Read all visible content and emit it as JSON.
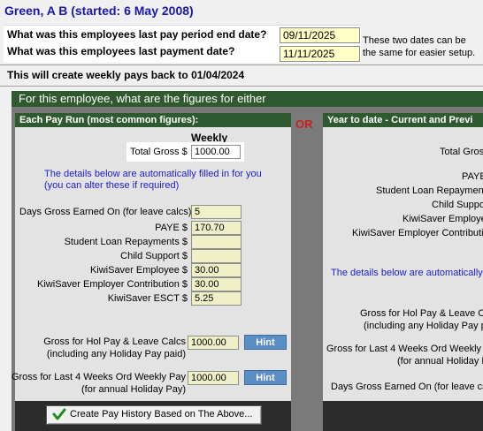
{
  "header": {
    "title": "Green, A B (started: 6 May 2008)"
  },
  "questions": {
    "end_date_label": "What was this employees last pay period end date?",
    "end_date_value": "09/11/2025",
    "payment_date_label": "What was this employees last payment date?",
    "payment_date_value": "11/11/2025",
    "note_line1": "These two dates can be",
    "note_line2": "the same for easier setup."
  },
  "create_info": "This will create weekly pays back to 01/04/2024",
  "band_title": "For this employee, what are the figures for either",
  "or_label": "OR",
  "left_panel": {
    "header": "Each Pay Run (most common figures):",
    "col_heading": "Weekly",
    "total_gross_label": "Total Gross $",
    "total_gross_value": "1000.00",
    "auto_note_line1": "The details below are automatically filled in for you",
    "auto_note_line2": "(you can alter these if required)",
    "rows": [
      {
        "label": "Days Gross Earned On (for leave calcs)",
        "value": "5"
      },
      {
        "label": "PAYE $",
        "value": "170.70"
      },
      {
        "label": "Student Loan Repayments $",
        "value": ""
      },
      {
        "label": "Child Support $",
        "value": ""
      },
      {
        "label": "KiwiSaver Employee $",
        "value": "30.00"
      },
      {
        "label": "KiwiSaver Employer Contribution $",
        "value": "30.00"
      },
      {
        "label": "KiwiSaver ESCT $",
        "value": "5.25"
      }
    ],
    "hol_label_line1": "Gross for Hol Pay & Leave Calcs",
    "hol_label_line2": "(including any Holiday Pay paid)",
    "hol_value": "1000.00",
    "last4_label_line1": "Gross for Last 4 Weeks Ord Weekly Pay",
    "last4_label_line2": "(for annual Holiday Pay)",
    "last4_value": "1000.00",
    "hint_label": "Hint",
    "create_button": "Create Pay History Based on The Above..."
  },
  "right_panel": {
    "header": "Year to date - Current and Previ",
    "total_gross_label": "Total Gros",
    "rows": [
      "PAYE",
      "Student Loan Repayment",
      "Child Suppo",
      "KiwiSaver Employe",
      "KiwiSaver Employer Contributio"
    ],
    "auto_note": "The details below are automatically f",
    "hol_label_line1": "Gross for Hol Pay & Leave Calc",
    "hol_label_line2": "(including any Holiday Pay pa",
    "last4_label_line1": "Gross for Last 4 Weeks Ord Weekly P",
    "last4_label_line2": "(for annual Holiday P",
    "days_label": "Days Gross Earned On (for leave calc"
  }
}
